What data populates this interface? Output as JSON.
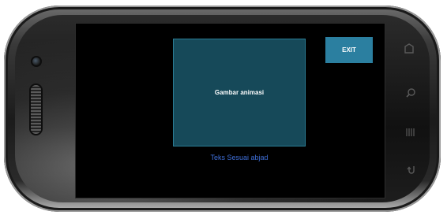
{
  "device": {
    "screen": {
      "animation_area": {
        "label": "Gambar animasi"
      },
      "exit_button": {
        "label": "EXIT"
      },
      "caption": "Teks Sesuai abjad"
    },
    "hardware_buttons": [
      {
        "icon": "back-icon"
      },
      {
        "icon": "search-icon"
      },
      {
        "icon": "menu-icon"
      },
      {
        "icon": "home-icon"
      }
    ]
  },
  "colors": {
    "screen_bg": "#000000",
    "animation_area_bg": "#164959",
    "exit_button_bg": "#2b7fa0",
    "caption_text": "#3f6fd8"
  }
}
